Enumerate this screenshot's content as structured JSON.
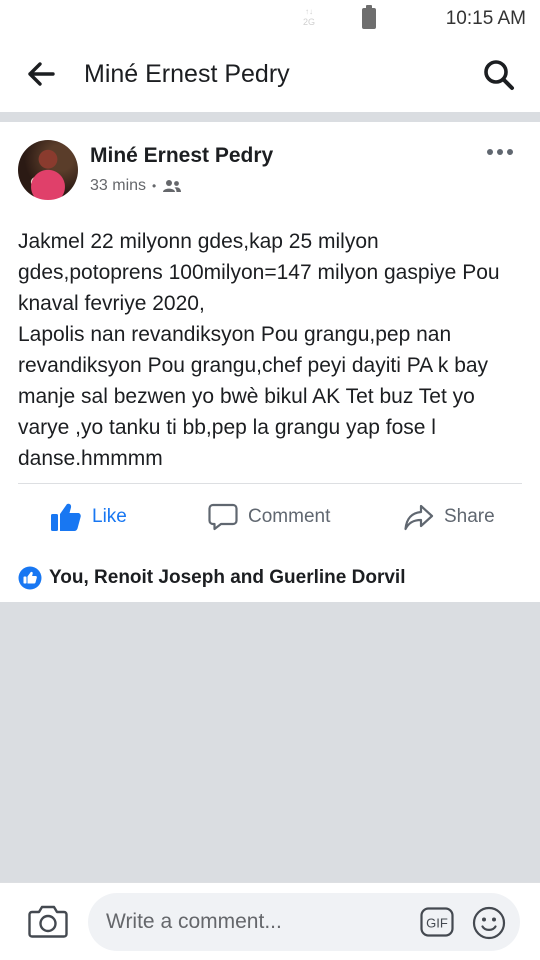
{
  "status_bar": {
    "network": "2G",
    "time": "10:15 AM"
  },
  "header": {
    "title": "Miné Ernest Pedry",
    "icons": {
      "back": "back-arrow-icon",
      "search": "search-icon"
    }
  },
  "post": {
    "author": "Miné Ernest Pedry",
    "time": "33 mins",
    "audience_icon": "friends-icon",
    "text": "Jakmel 22 milyonn gdes,kap 25 milyon gdes,potoprens 100milyon=147 milyon gaspiye Pou knaval fevriye 2020,\nLapolis nan revandiksyon Pou grangu,pep nan revandiksyon Pou grangu,chef peyi dayiti PA k bay manje sal bezwen yo bwè bikul AK Tet buz Tet yo varye ,yo tanku ti bb,pep la grangu yap fose l danse.hmmmm",
    "actions": {
      "like": "Like",
      "comment": "Comment",
      "share": "Share"
    },
    "reactions_text": "You, Renoit Joseph and Guerline Dorvil"
  },
  "comment_bar": {
    "placeholder": "Write a comment...",
    "gif_label": "GIF"
  },
  "colors": {
    "accent": "#1877f2",
    "text": "#1c1e21",
    "secondary_text": "#65676b",
    "background": "#dadde1"
  }
}
